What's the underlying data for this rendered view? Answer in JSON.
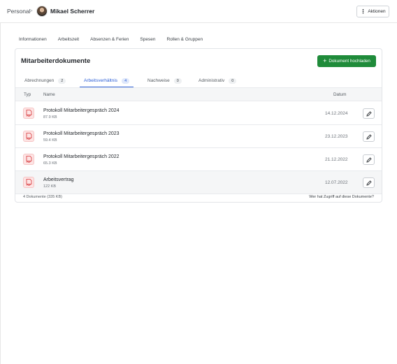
{
  "breadcrumb": {
    "root": "Personal",
    "separator": ">",
    "person_name": "Mikael Scherrer"
  },
  "header": {
    "actions_label": "Aktionen"
  },
  "main_tabs": [
    {
      "label": "Informationen"
    },
    {
      "label": "Arbeitszeit"
    },
    {
      "label": "Absenzen & Ferien"
    },
    {
      "label": "Spesen"
    },
    {
      "label": "Rollen & Gruppen"
    }
  ],
  "card": {
    "title": "Mitarbeiterdokumente",
    "upload_label": "Dokument hochladen"
  },
  "sub_tabs": [
    {
      "label": "Abrechnungen",
      "count": "2",
      "active": false
    },
    {
      "label": "Arbeitsverhältnis",
      "count": "4",
      "active": true
    },
    {
      "label": "Nachweise",
      "count": "0",
      "active": false
    },
    {
      "label": "Administrativ",
      "count": "0",
      "active": false
    }
  ],
  "table": {
    "headers": {
      "typ": "Typ",
      "name": "Name",
      "datum": "Datum"
    },
    "rows": [
      {
        "name": "Protokoll Mitarbeitergespräch 2024",
        "size": "87.9 KB",
        "date": "14.12.2024",
        "icon": "pdf-icon"
      },
      {
        "name": "Protokoll Mitarbeitergespräch 2023",
        "size": "59.4 KB",
        "date": "23.12.2023",
        "icon": "pdf-icon"
      },
      {
        "name": "Protokoll Mitarbeitergespräch 2022",
        "size": "65.3 KB",
        "date": "21.12.2022",
        "icon": "pdf-icon"
      },
      {
        "name": "Arbeitsvertrag",
        "size": "122 KB",
        "date": "12.07.2022",
        "icon": "pdf-icon"
      }
    ],
    "pdf_label": "PDF"
  },
  "footer": {
    "count_text": "4 Dokumente (335 KB)",
    "who_text": "Wer hat Zugriff auf diese Dokumente?"
  },
  "colors": {
    "accent_blue": "#2c5fd6",
    "upload_green": "#1f8b3a",
    "pdf_red": "#d6373b"
  }
}
